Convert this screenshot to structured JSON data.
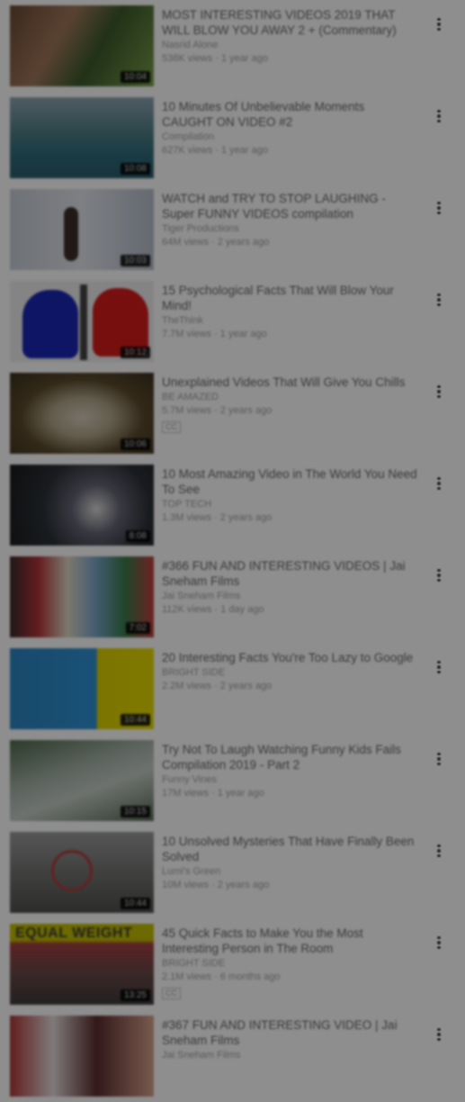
{
  "videos": [
    {
      "title": "MOST INTERESTING VIDEOS 2019 THAT WILL BLOW YOU AWAY 2 + (Commentary)",
      "channel": "Nasrid Alone",
      "meta": "538K views · 1 year ago",
      "duration": "10:04",
      "badge": ""
    },
    {
      "title": "10 Minutes Of Unbelievable Moments CAUGHT ON VIDEO #2",
      "channel": "Compilation",
      "meta": "627K views · 1 year ago",
      "duration": "10:08",
      "badge": ""
    },
    {
      "title": "WATCH and TRY TO STOP LAUGHING - Super FUNNY VIDEOS compilation",
      "channel": "Tiger Productions",
      "meta": "64M views · 2 years ago",
      "duration": "10:03",
      "badge": ""
    },
    {
      "title": "15 Psychological Facts That Will Blow Your Mind!",
      "channel": "TheThink",
      "meta": "7.7M views · 1 year ago",
      "duration": "10:12",
      "badge": ""
    },
    {
      "title": "Unexplained Videos That Will Give You Chills",
      "channel": "BE AMAZED",
      "meta": "5.7M views · 2 years ago",
      "duration": "10:06",
      "badge": "CC"
    },
    {
      "title": "10 Most Amazing Video in The World You Need To See",
      "channel": "TOP TECH",
      "meta": "1.3M views · 2 years ago",
      "duration": "8:08",
      "badge": ""
    },
    {
      "title": "#366 FUN AND INTERESTING VIDEOS | Jai Sneham Films",
      "channel": "Jai Sneham Films",
      "meta": "112K views · 1 day ago",
      "duration": "7:02",
      "badge": ""
    },
    {
      "title": "20 Interesting Facts You're Too Lazy to Google",
      "channel": "BRIGHT SIDE",
      "meta": "2.2M views · 2 years ago",
      "duration": "10:44",
      "badge": ""
    },
    {
      "title": "Try Not To Laugh Watching Funny Kids Fails Compilation 2019 - Part 2",
      "channel": "Funny Vines",
      "meta": "17M views · 1 year ago",
      "duration": "10:15",
      "badge": ""
    },
    {
      "title": "10 Unsolved Mysteries That Have Finally Been Solved",
      "channel": "Lumi's Green",
      "meta": "10M views · 2 years ago",
      "duration": "10:44",
      "badge": ""
    },
    {
      "title": "45 Quick Facts to Make You the Most Interesting Person in The Room",
      "channel": "BRIGHT SIDE",
      "meta": "2.1M views · 6 months ago",
      "duration": "13:25",
      "badge": "CC",
      "caption": "EQUAL WEIGHT"
    },
    {
      "title": "#367 FUN AND INTERESTING VIDEO | Jai Sneham Films",
      "channel": "Jai Sneham Films",
      "meta": "",
      "duration": "",
      "badge": ""
    }
  ],
  "icons": {
    "menu": "more-vert-icon"
  }
}
